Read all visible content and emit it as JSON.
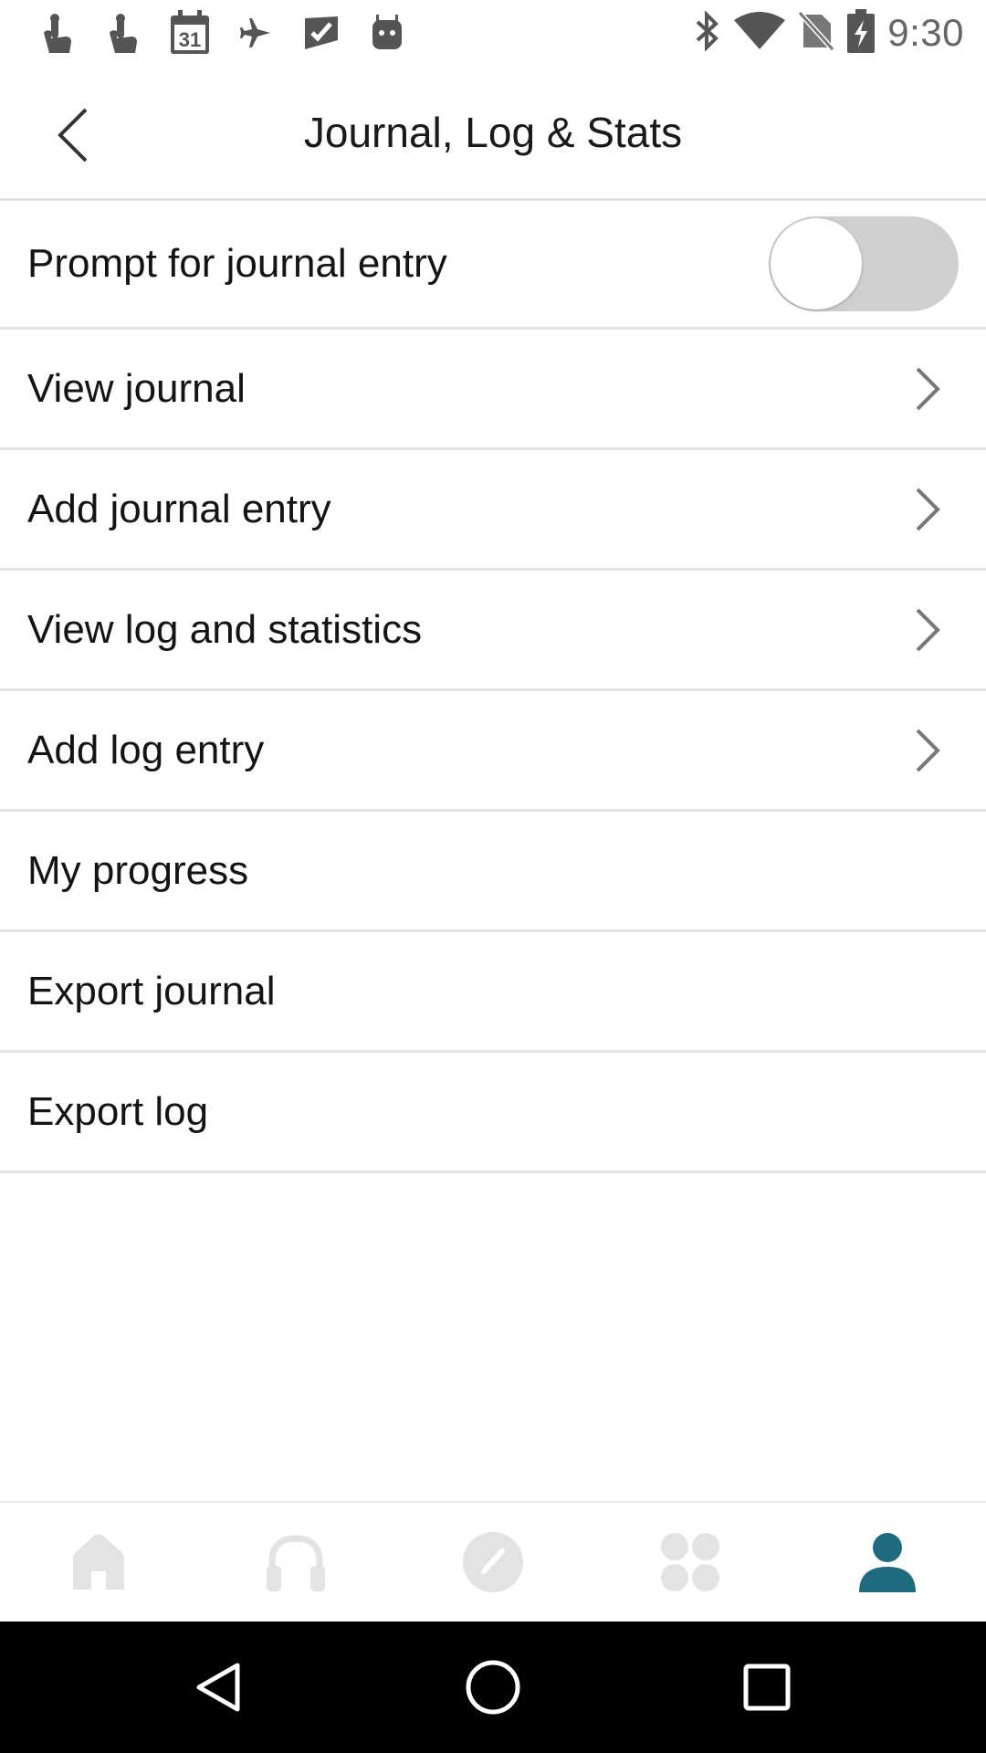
{
  "status_bar": {
    "left_icons": [
      "touch-icon",
      "touch-icon",
      "calendar-icon",
      "airplane-icon",
      "inbox-check-icon",
      "android-icon"
    ],
    "calendar_day": "31",
    "right_icons": [
      "bluetooth-icon",
      "wifi-icon",
      "no-sim-icon",
      "battery-charging-icon"
    ],
    "time": "9:30"
  },
  "header": {
    "title": "Journal, Log & Stats"
  },
  "settings": {
    "prompt_toggle": {
      "label": "Prompt for journal entry",
      "enabled": false
    },
    "items": [
      {
        "label": "View journal",
        "has_chevron": true
      },
      {
        "label": "Add journal entry",
        "has_chevron": true
      },
      {
        "label": "View log and statistics",
        "has_chevron": true
      },
      {
        "label": "Add log entry",
        "has_chevron": true
      },
      {
        "label": "My progress",
        "has_chevron": false
      },
      {
        "label": "Export journal",
        "has_chevron": false
      },
      {
        "label": "Export log",
        "has_chevron": false
      }
    ]
  },
  "bottom_nav": {
    "items": [
      "home-icon",
      "headphones-icon",
      "compass-icon",
      "apps-icon",
      "profile-icon"
    ],
    "active_index": 4
  },
  "colors": {
    "accent": "#1e6b80",
    "inactive_icon": "#e3e3e3",
    "divider": "#e3e3e3",
    "toggle_track_off": "#cfcfcf"
  }
}
